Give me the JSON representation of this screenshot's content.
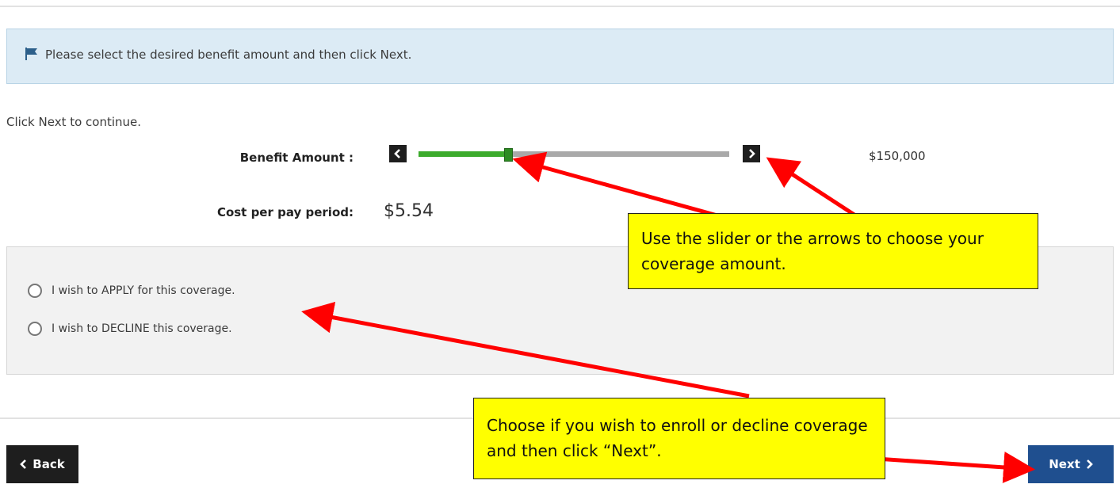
{
  "notice": {
    "icon": "flag-icon",
    "message": "Please select the desired benefit amount and then click Next."
  },
  "instruction": "Click Next to continue.",
  "benefit": {
    "label": "Benefit Amount :",
    "prev_icon": "chevron-left-icon",
    "next_icon": "chevron-right-icon",
    "slider_level": 0.29,
    "amount": "$150,000"
  },
  "cost": {
    "label": "Cost per pay period:",
    "value": "$5.54"
  },
  "coverage_options": [
    {
      "label": "I wish to APPLY for this coverage.",
      "selected": false
    },
    {
      "label": "I wish to DECLINE this coverage.",
      "selected": false
    }
  ],
  "buttons": {
    "back_label": "Back",
    "back_icon": "chevron-left-icon",
    "next_label": "Next",
    "next_icon": "chevron-right-icon"
  },
  "callouts": {
    "slider_tip": "Use the slider or the arrows to choose your coverage amount.",
    "coverage_tip": "Choose if you wish to enroll or decline coverage and then click “Next”."
  },
  "colors": {
    "notice_bg": "#dcebf5",
    "slider_fill": "#3cab2c",
    "slider_track": "#a9a9a9",
    "next_button": "#1f4f8f",
    "back_button": "#1e1e1e",
    "callout_bg": "#ffff00",
    "annotation_arrow": "#ff0000"
  }
}
